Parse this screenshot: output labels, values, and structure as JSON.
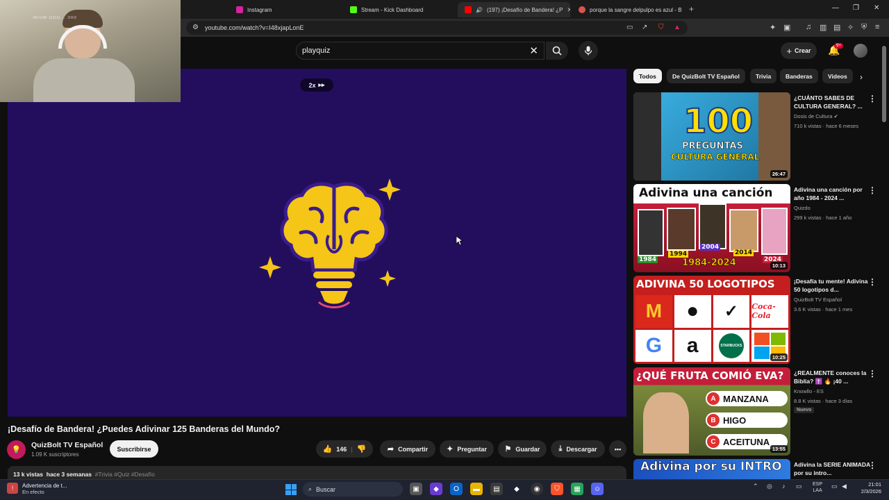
{
  "browser": {
    "tabs": [
      {
        "title": "Instagram",
        "favicon_color": "#d6249f"
      },
      {
        "title": "Stream - Kick Dashboard",
        "favicon_color": "#53fc18"
      },
      {
        "title": "(197) ¡Desafío de Bandera! ¿P",
        "favicon_color": "#ff0000",
        "active": true
      },
      {
        "title": "porque la sangre delpulpo es azul - B",
        "favicon_color": "#d9534f"
      }
    ],
    "url": "youtube.com/watch?v=I48xjapLonE",
    "new_tab_icon": "+",
    "window_controls": {
      "minimize": "—",
      "restore": "❐",
      "close": "✕"
    }
  },
  "webcam": {
    "overlay_text": "MIUM DOD... 000"
  },
  "header": {
    "search_value": "playquiz",
    "create_label": "Crear",
    "notifications_badge": "9+"
  },
  "player": {
    "speed_label": "2x",
    "background": "#230e5e",
    "bulb_color": "#f5c518",
    "bulb_outline": "#3a1c8c"
  },
  "video": {
    "title": "¡Desafío de Bandera! ¿Puedes Adivinar 125 Banderas del Mundo?",
    "channel_name": "QuizBolt TV Español",
    "subscribers": "1.09 K suscriptores",
    "subscribe_label": "Suscribirse",
    "likes": "146",
    "share_label": "Compartir",
    "ask_label": "Preguntar",
    "save_label": "Guardar",
    "download_label": "Descargar",
    "views": "13 k vistas",
    "date": "hace 3 semanas",
    "tags": "#Trivia #Quiz #Desafío"
  },
  "chips": [
    "Todos",
    "De QuizBolt TV Español",
    "Trivia",
    "Banderas",
    "Videos"
  ],
  "recommendations": [
    {
      "title": "¿CUÁNTO SABES DE CULTURA GENERAL? ...",
      "channel": "Dosis de Cultura",
      "verified": true,
      "meta": "710 k vistas · hace 6 meses",
      "duration": "26:47",
      "thumb_line1": "100",
      "thumb_line2": "PREGUNTAS",
      "thumb_line3": "CULTURA GENERAL"
    },
    {
      "title": "Adivina una canción por año 1984 - 2024 ...",
      "channel": "Quizdo",
      "meta": "299 k vistas · hace 1 año",
      "duration": "10:13",
      "thumb_line1": "Adivina una canción",
      "thumb_line2": "1984-2024",
      "thumb_years": [
        "1984",
        "1994",
        "2004",
        "2014",
        "2024"
      ]
    },
    {
      "title": "¡Desafía tu mente! Adivina 50 logotipos d...",
      "channel": "QuizBolt TV Español",
      "meta": "3.6 K vistas · hace 1 mes",
      "duration": "10:25",
      "thumb_line1": "ADIVINA 50 LOGOTIPOS",
      "thumb_logos": [
        "M",
        "",
        "✓",
        "Coca-Cola",
        "G",
        "a",
        "STARBUCKS",
        ""
      ]
    },
    {
      "title": "¿REALMENTE conoces la Biblia? ✝️ 🔥 ¡40 ...",
      "channel": "Knowllo - ES",
      "meta": "8.8 K vistas · hace 3 días",
      "duration": "13:55",
      "badge": "Nuevo",
      "thumb_line1": "¿QUÉ FRUTA COMIÓ EVA?",
      "thumb_options": [
        {
          "letter": "A",
          "text": "MANZANA"
        },
        {
          "letter": "B",
          "text": "HIGO"
        },
        {
          "letter": "C",
          "text": "ACEITUNA"
        }
      ]
    },
    {
      "title": "Adivina la SERIE ANIMADA por su intro...",
      "channel": "",
      "meta": "",
      "thumb_line1": "Adivina por su INTRO"
    }
  ],
  "taskbar": {
    "notification_title": "Advertencia de t...",
    "notification_subtitle": "En efecto",
    "search_placeholder": "Buscar",
    "language": "ESP",
    "layout": "LAA",
    "time": "21:01",
    "date": "2/3/2026"
  }
}
